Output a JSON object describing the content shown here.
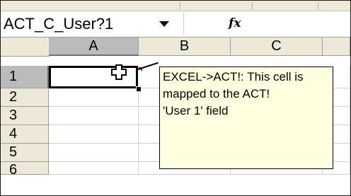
{
  "name_box": {
    "value": "ACT_C_User?1"
  },
  "formula_bar": {
    "fx_label": "fx",
    "value": ""
  },
  "columns": [
    "A",
    "B",
    "C"
  ],
  "rows": [
    "1",
    "2",
    "3",
    "4",
    "5",
    "6"
  ],
  "selected_cell": {
    "column": "A",
    "row": "1"
  },
  "comment": {
    "line1": "EXCEL->ACT!: This cell is",
    "line2": "mapped to the ACT!",
    "line3": "'User 1' field"
  }
}
